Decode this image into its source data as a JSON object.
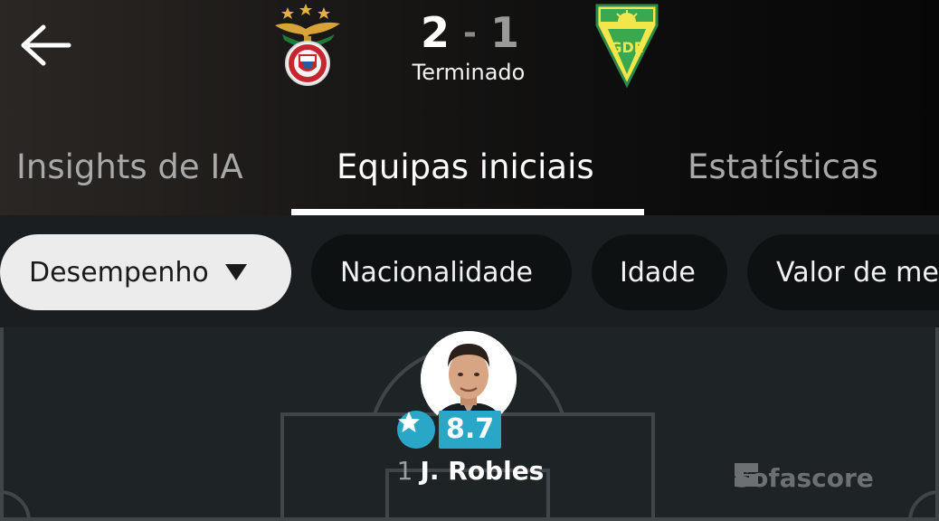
{
  "match": {
    "home_score": "2",
    "separator": "-",
    "away_score": "1",
    "status": "Terminado",
    "home_crest_icon": "benfica-crest-icon",
    "away_crest_icon": "estoril-crest-icon"
  },
  "tabs": [
    {
      "label": "Insights de IA",
      "active": false
    },
    {
      "label": "Equipas iniciais",
      "active": true
    },
    {
      "label": "Estatísticas",
      "active": false
    }
  ],
  "filters": [
    {
      "label": "Desempenho",
      "selected": true,
      "has_dropdown": true
    },
    {
      "label": "Nacionalidade",
      "selected": false
    },
    {
      "label": "Idade",
      "selected": false
    },
    {
      "label": "Valor de mercado",
      "selected": false
    }
  ],
  "player": {
    "number": "1",
    "name": "J. Robles",
    "rating": "8.7"
  },
  "watermark": "Sofascore",
  "colors": {
    "rating_badge": "#2aa7c7",
    "pitch": "#1e2326",
    "chip_selected": "#ececec",
    "chip": "#0e1112"
  }
}
